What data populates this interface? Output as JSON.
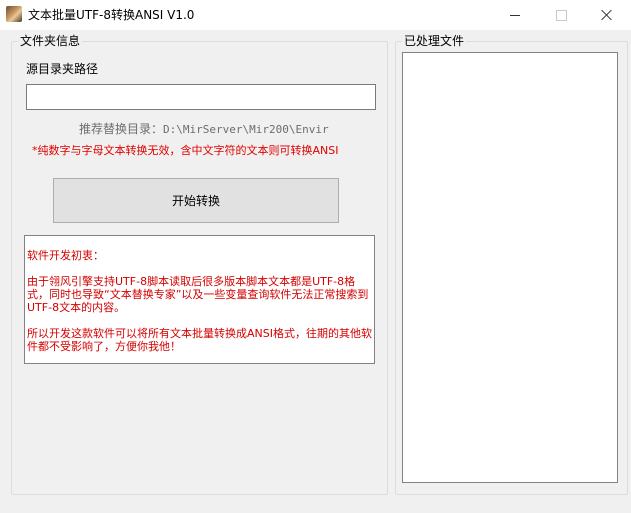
{
  "window": {
    "title": "文本批量UTF-8转换ANSI  V1.0"
  },
  "left_group": {
    "legend": "文件夹信息",
    "source_label": "源目录夹路径",
    "source_value": "",
    "recommend_prefix": "推荐替换目录：",
    "recommend_path": "D:\\MirServer\\Mir200\\Envir",
    "warning": "*纯数字与字母文本转换无效，含中文字符的文本则可转换ANSI",
    "start_button": "开始转换",
    "info": {
      "heading": "软件开发初衷：",
      "paragraph1": "由于翎风引擎支持UTF-8脚本读取后很多版本脚本文本都是UTF-8格式，同时也导致“文本替换专家”以及一些变量查询软件无法正常搜索到UTF-8文本的内容。",
      "paragraph2": "所以开发这款软件可以将所有文本批量转换成ANSI格式，往期的其他软件都不受影响了，方便你我他！"
    }
  },
  "right_group": {
    "legend": "已处理文件",
    "items": []
  },
  "colors": {
    "background": "#f0f0f0",
    "warning_red": "#e00000",
    "info_red": "#d40000",
    "hint_gray": "#6d6d6d"
  }
}
